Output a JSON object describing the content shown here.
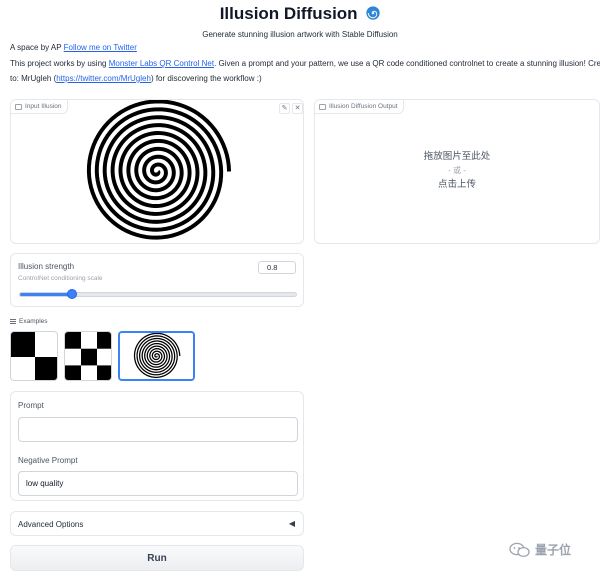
{
  "header": {
    "title": "Illusion Diffusion",
    "subtitle": "Generate stunning illusion artwork with Stable Diffusion",
    "credit_prefix": "A space by AP ",
    "credit_link": "Follow me on Twitter",
    "desc_prefix": "This project works by using ",
    "desc_link": "Monster Labs QR Control Net",
    "desc_suffix": ". Given a prompt and your pattern, we use a QR code conditioned controlnet to create a stunning illusion! Credit",
    "desc2_prefix": "to: MrUgleh (",
    "desc2_link": "https://twitter.com/MrUgleh",
    "desc2_suffix": ") for discovering the workflow :)"
  },
  "input_image": {
    "label": "Input Illusion",
    "edit_icon": "pencil-icon",
    "close_icon": "close-icon"
  },
  "output_image": {
    "label": "Illusion Diffusion Output",
    "drop_text": "拖放图片至此处",
    "or_text": "- 或 -",
    "click_text": "点击上传"
  },
  "strength": {
    "label": "Illusion strength",
    "info": "ControlNet conditioning scale",
    "value": "0.8",
    "fraction": 0.19
  },
  "examples": {
    "label": "Examples",
    "items": [
      "checkerboard-2x2",
      "checkerboard-3x3",
      "spiral"
    ],
    "selected": 2
  },
  "prompt": {
    "label": "Prompt",
    "value": ""
  },
  "negative_prompt": {
    "label": "Negative Prompt",
    "value": "low quality"
  },
  "advanced": {
    "label": "Advanced Options",
    "caret": "◀"
  },
  "run_button": {
    "label": "Run"
  },
  "watermark": {
    "text": "量子位"
  },
  "colors": {
    "accent": "#3b82f6",
    "link": "#2563eb"
  }
}
